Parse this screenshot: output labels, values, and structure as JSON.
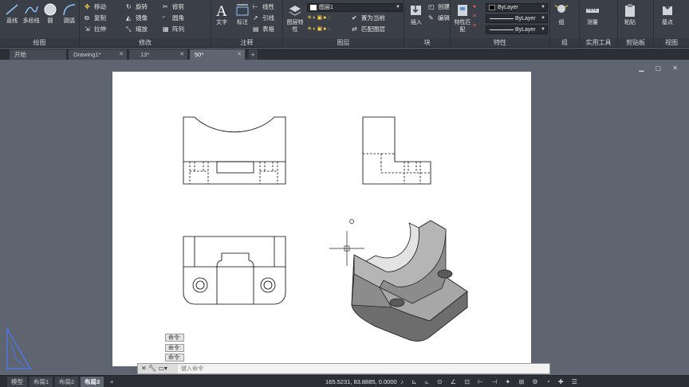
{
  "ribbon": {
    "draw": {
      "title": "绘图",
      "line": "直线",
      "polyline": "多段线",
      "circle": "圆",
      "arc": "圆弧"
    },
    "modify": {
      "title": "修改",
      "move": "移动",
      "rotate": "旋转",
      "trim": "修剪",
      "copy": "复制",
      "mirror": "镜像",
      "fillet": "圆角",
      "stretch": "拉伸",
      "scale": "缩放",
      "array": "阵列"
    },
    "annotation": {
      "title": "注释",
      "text": "文字",
      "dimension": "标注",
      "linear": "线性",
      "leader": "引线",
      "table": "表格"
    },
    "layers": {
      "title": "图层",
      "properties": "图层特性",
      "current_layer": "图层1",
      "make_current": "置为当前",
      "match_layer": "匹配图层"
    },
    "block": {
      "title": "块",
      "insert": "插入",
      "create": "创建",
      "edit": "编辑"
    },
    "properties": {
      "title": "特性",
      "match": "特性匹配",
      "color": "ByLayer",
      "linetype": "ByLayer",
      "lineweight": "ByLayer"
    },
    "groups": {
      "title": "组",
      "group": "组"
    },
    "utilities": {
      "title": "实用工具",
      "measure": "测量"
    },
    "clipboard": {
      "title": "剪贴板",
      "paste": "粘贴"
    },
    "view": {
      "title": "视图",
      "basepoint": "基点"
    }
  },
  "file_tabs": [
    {
      "label": "开始",
      "active": false
    },
    {
      "label": "Drawing1*",
      "active": false
    },
    {
      "label": "13*",
      "active": false
    },
    {
      "label": "50*",
      "active": true
    }
  ],
  "command_history": [
    "命令:",
    "命令:",
    "命令:"
  ],
  "command_placeholder": "键入命令",
  "layout_tabs": [
    {
      "label": "模型",
      "active": false
    },
    {
      "label": "布局1",
      "active": false
    },
    {
      "label": "布局2",
      "active": false
    },
    {
      "label": "布局3",
      "active": true
    }
  ],
  "coordinates": "165.5231, 83.8885, 0.0000",
  "colors": {
    "ribbon_bg": "#3b4048",
    "canvas_bg": "#5e6470",
    "paper": "#ffffff",
    "model_fill": "#8a8a8a"
  }
}
